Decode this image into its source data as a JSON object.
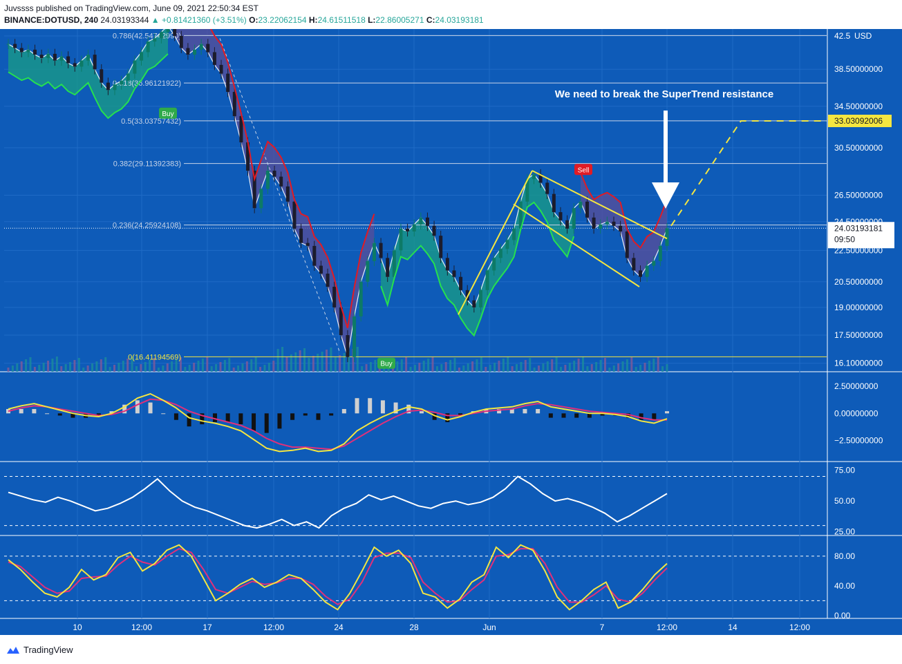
{
  "header": {
    "line1": "Juvssss published on TradingView.com, June 09, 2021 22:50:34 EST",
    "symbol": "BINANCE:DOTUSD, 240",
    "last": "24.03193344",
    "change": "▲ +0.81421360 (+3.51%)",
    "o_label": "O:",
    "o": "23.22062154",
    "h_label": "H:",
    "h": "24.61511518",
    "l_label": "L:",
    "l": "22.86005271",
    "c_label": "C:",
    "c": "24.03193181"
  },
  "footer": {
    "brand": "TradingView"
  },
  "colors": {
    "background": "#0e5bb8",
    "grid": "#1f6bc6",
    "up_candle": "#0d7a66",
    "down_candle": "#1c1c2c",
    "supertrend_up": "#26e04f",
    "supertrend_down": "#e01b24",
    "fill_up": "#1a9c86",
    "fill_down": "#5a4d9a",
    "yellow": "#f5e640",
    "white": "#ffffff"
  },
  "chart_data": [
    {
      "type": "line",
      "name": "price",
      "currency_label": "USD",
      "y_ticks": [
        "42.5",
        "38.50000000",
        "34.50000000",
        "30.50000000",
        "26.50000000",
        "24.50000000",
        "22.50000000",
        "20.50000000",
        "19.00000000",
        "17.50000000",
        "16.10000000"
      ],
      "x_ticks": [
        "10",
        "12:00",
        "17",
        "12:00",
        "24",
        "28",
        "Jun",
        "7",
        "12:00",
        "14",
        "12:00"
      ],
      "price_label": "24.03193181",
      "countdown": "09:50",
      "target_label": "33.03092006",
      "fib_levels": [
        {
          "label": "0.786(42.54742990)",
          "price": 42.55
        },
        {
          "label": "0.618(36.96121922)",
          "price": 36.96
        },
        {
          "label": "0.5(33.03757432)",
          "price": 33.04
        },
        {
          "label": "0.382(29.11392383)",
          "price": 29.11
        },
        {
          "label": "0.236(24.25924108)",
          "price": 24.26
        },
        {
          "label": "0(16.41194569)",
          "price": 16.41
        }
      ],
      "annotation": "We need to break the SuperTrend resistance",
      "signals": [
        "Buy",
        "Buy",
        "Sell"
      ],
      "close_series": [
        41.5,
        41.0,
        40.5,
        40.8,
        40.2,
        39.8,
        40.3,
        39.5,
        40.0,
        39.2,
        38.8,
        39.5,
        40.2,
        38.5,
        37.0,
        36.2,
        36.8,
        37.2,
        38.0,
        39.5,
        40.5,
        41.8,
        42.2,
        43.0,
        43.8,
        42.5,
        41.0,
        40.2,
        40.8,
        41.5,
        40.5,
        39.0,
        38.0,
        36.0,
        33.5,
        31.0,
        28.5,
        25.5,
        27.0,
        28.5,
        28.0,
        27.2,
        26.0,
        24.0,
        23.0,
        22.8,
        21.5,
        21.0,
        20.2,
        19.0,
        17.5,
        16.4,
        18.5,
        20.5,
        21.8,
        23.0,
        22.0,
        20.8,
        22.5,
        24.0,
        23.8,
        24.3,
        24.8,
        24.2,
        23.5,
        22.0,
        21.2,
        20.8,
        20.0,
        19.4,
        19.0,
        20.0,
        21.2,
        22.0,
        22.6,
        23.2,
        24.0,
        26.0,
        27.8,
        28.2,
        27.5,
        26.6,
        25.2,
        24.6,
        24.0,
        25.5,
        26.0,
        24.8,
        24.0,
        24.3,
        24.5,
        24.2,
        23.8,
        22.0,
        21.2,
        20.8,
        21.5,
        21.8,
        22.8,
        24.03
      ]
    },
    {
      "type": "line",
      "name": "macd",
      "y_ticks": [
        "2.50000000",
        "0.00000000",
        "−2.50000000"
      ],
      "macd": [
        0.4,
        0.7,
        0.9,
        0.6,
        0.3,
        0.0,
        -0.2,
        -0.3,
        0.0,
        0.6,
        1.4,
        1.8,
        1.2,
        0.5,
        -0.4,
        -0.7,
        -0.9,
        -1.2,
        -1.6,
        -2.4,
        -3.2,
        -3.5,
        -3.4,
        -3.2,
        -3.5,
        -3.4,
        -2.8,
        -1.6,
        -0.9,
        -0.3,
        0.2,
        0.6,
        0.4,
        -0.2,
        -0.6,
        -0.3,
        0.1,
        0.4,
        0.5,
        0.6,
        0.9,
        1.1,
        0.6,
        0.4,
        0.2,
        0.0,
        0.0,
        -0.1,
        -0.3,
        -0.7,
        -0.9,
        -0.5
      ],
      "signal": [
        0.2,
        0.5,
        0.7,
        0.6,
        0.4,
        0.2,
        0.0,
        -0.2,
        -0.1,
        0.2,
        0.8,
        1.3,
        1.2,
        0.8,
        0.2,
        -0.2,
        -0.5,
        -0.8,
        -1.1,
        -1.6,
        -2.3,
        -2.8,
        -3.1,
        -3.1,
        -3.2,
        -3.3,
        -3.0,
        -2.3,
        -1.6,
        -0.9,
        -0.3,
        0.2,
        0.3,
        0.1,
        -0.2,
        -0.2,
        0.0,
        0.2,
        0.3,
        0.4,
        0.7,
        0.9,
        0.8,
        0.6,
        0.4,
        0.2,
        0.1,
        0.0,
        -0.1,
        -0.4,
        -0.6,
        -0.6
      ]
    },
    {
      "type": "line",
      "name": "rsi",
      "y_ticks": [
        "75.00",
        "50.00",
        "25.00"
      ],
      "values": [
        57,
        54,
        51,
        49,
        53,
        50,
        46,
        42,
        44,
        48,
        53,
        60,
        68,
        58,
        50,
        45,
        42,
        38,
        34,
        30,
        28,
        31,
        35,
        30,
        33,
        28,
        38,
        44,
        48,
        55,
        51,
        54,
        50,
        46,
        44,
        48,
        50,
        47,
        49,
        53,
        60,
        70,
        64,
        56,
        50,
        52,
        49,
        45,
        40,
        33,
        38,
        44,
        50,
        56
      ]
    },
    {
      "type": "line",
      "name": "stochastic",
      "y_ticks": [
        "80.00",
        "40.00",
        "0.00"
      ],
      "k": [
        75,
        62,
        45,
        30,
        25,
        38,
        62,
        48,
        55,
        78,
        85,
        60,
        70,
        88,
        95,
        80,
        50,
        20,
        30,
        42,
        50,
        38,
        45,
        55,
        50,
        35,
        18,
        8,
        30,
        60,
        92,
        80,
        88,
        70,
        30,
        25,
        10,
        22,
        45,
        55,
        92,
        78,
        95,
        88,
        60,
        25,
        8,
        20,
        35,
        45,
        10,
        18,
        35,
        55,
        70
      ],
      "d": [
        72,
        66,
        52,
        38,
        30,
        33,
        50,
        52,
        53,
        68,
        80,
        72,
        68,
        80,
        90,
        85,
        62,
        35,
        30,
        38,
        46,
        42,
        44,
        50,
        50,
        42,
        26,
        15,
        22,
        45,
        78,
        84,
        84,
        78,
        45,
        30,
        18,
        20,
        35,
        48,
        80,
        82,
        90,
        90,
        70,
        38,
        18,
        18,
        28,
        40,
        22,
        18,
        30,
        48,
        64
      ]
    }
  ]
}
